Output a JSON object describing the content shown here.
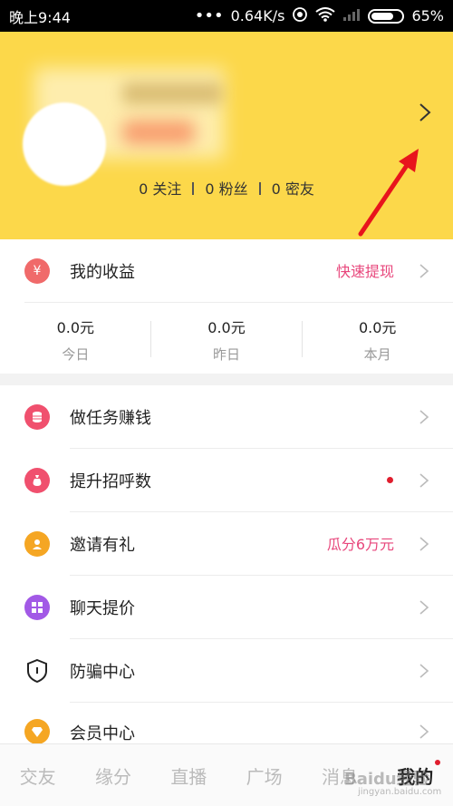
{
  "status_bar": {
    "time": "晚上9:44",
    "speed": "0.64K/s",
    "battery": "65%"
  },
  "profile": {
    "follow_count": "0 关注",
    "fans_count": "0 粉丝",
    "close_friends_count": "0 密友"
  },
  "earnings": {
    "title": "我的收益",
    "action": "快速提现",
    "stats": [
      {
        "value": "0.0元",
        "label": "今日"
      },
      {
        "value": "0.0元",
        "label": "昨日"
      },
      {
        "value": "0.0元",
        "label": "本月"
      }
    ]
  },
  "menu": [
    {
      "label": "做任务赚钱",
      "extra": "",
      "icon": "coin-stack-icon",
      "color": "#f0506e"
    },
    {
      "label": "提升招呼数",
      "extra": "",
      "icon": "money-bag-icon",
      "color": "#f0506e",
      "dot": true
    },
    {
      "label": "邀请有礼",
      "extra": "瓜分6万元",
      "icon": "person-icon",
      "color": "#f5a623"
    },
    {
      "label": "聊天提价",
      "extra": "",
      "icon": "grid-icon",
      "color": "#a259e6"
    },
    {
      "label": "防骗中心",
      "extra": "",
      "icon": "shield-icon",
      "color": "#222222"
    },
    {
      "label": "会员中心",
      "extra": "",
      "icon": "diamond-icon",
      "color": "#f5a623"
    }
  ],
  "tabs": [
    {
      "label": "交友",
      "active": false
    },
    {
      "label": "缘分",
      "active": false
    },
    {
      "label": "直播",
      "active": false
    },
    {
      "label": "广场",
      "active": false
    },
    {
      "label": "消息",
      "active": false
    },
    {
      "label": "我的",
      "active": true
    }
  ],
  "watermark": {
    "text": "Baidu经验",
    "sub": "jingyan.baidu.com"
  },
  "colors": {
    "header": "#fcd84a",
    "accent_pink": "#e8477c",
    "dot_red": "#e01e2e"
  }
}
